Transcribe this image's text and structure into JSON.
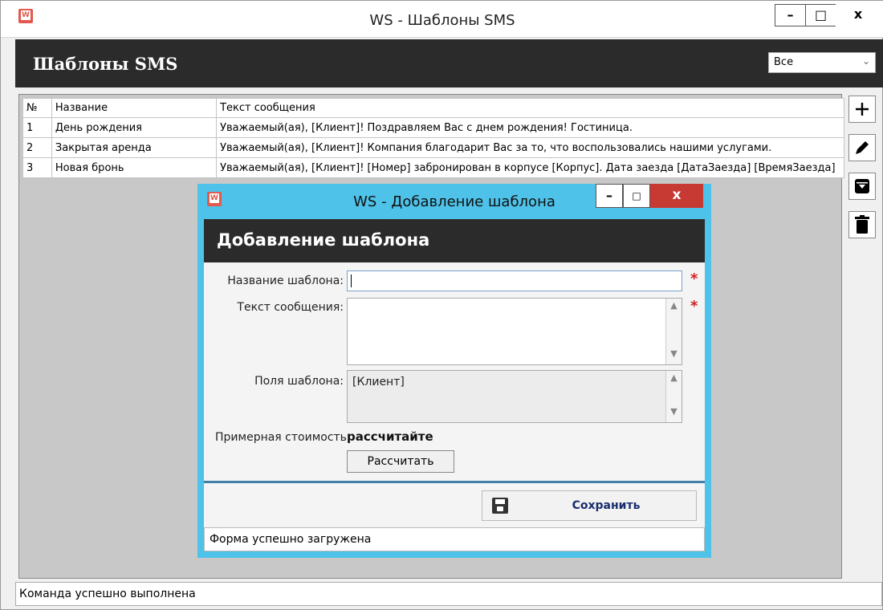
{
  "main_window": {
    "title": "WS - Шаблоны SMS",
    "app_icon_letter": "W",
    "controls": {
      "minimize": "–",
      "maximize": "□",
      "close": "x"
    }
  },
  "header": {
    "title": "Шаблоны SMS",
    "filter": {
      "selected": "Все",
      "chevron": "⌄"
    }
  },
  "table": {
    "columns": [
      "№",
      "Название",
      "Текст сообщения"
    ],
    "rows": [
      [
        "1",
        "День рождения",
        "Уважаемый(ая), [Клиент]! Поздравляем Вас с днем рождения! Гостиница."
      ],
      [
        "2",
        "Закрытая аренда",
        "Уважаемый(ая), [Клиент]! Компания благодарит Вас за то, что воспользовались нашими услугами."
      ],
      [
        "3",
        "Новая бронь",
        "Уважаемый(ая), [Клиент]! [Номер] забронирован в корпусе [Корпус]. Дата заезда [ДатаЗаезда] [ВремяЗаезда]"
      ]
    ]
  },
  "toolbar": {
    "add_icon": "plus-icon",
    "edit_icon": "pencil-icon",
    "archive_icon": "archive-icon",
    "delete_icon": "trash-icon"
  },
  "main_status": "Команда успешно выполнена",
  "dialog": {
    "title": "WS - Добавление шаблона",
    "app_icon_letter": "W",
    "controls": {
      "minimize": "–",
      "maximize": "□",
      "close": "x"
    },
    "header_title": "Добавление шаблона",
    "fields": {
      "name_label": "Название шаблона:",
      "name_value": "",
      "text_label": "Текст сообщения:",
      "text_value": "",
      "template_fields_label": "Поля шаблона:",
      "template_fields_value": "[Клиент]",
      "required_mark": "*"
    },
    "cost": {
      "label": "Примерная стоимость:",
      "value": "рассчитайте"
    },
    "calc_button": "Рассчитать",
    "save_button": "Сохранить",
    "status": "Форма успешно загружена"
  },
  "colors": {
    "dialog_frame": "#4ec2e8",
    "header_bg": "#2b2b2b",
    "close_red": "#c73a33",
    "required_red": "#d32020",
    "save_text": "#1a2e6e"
  }
}
